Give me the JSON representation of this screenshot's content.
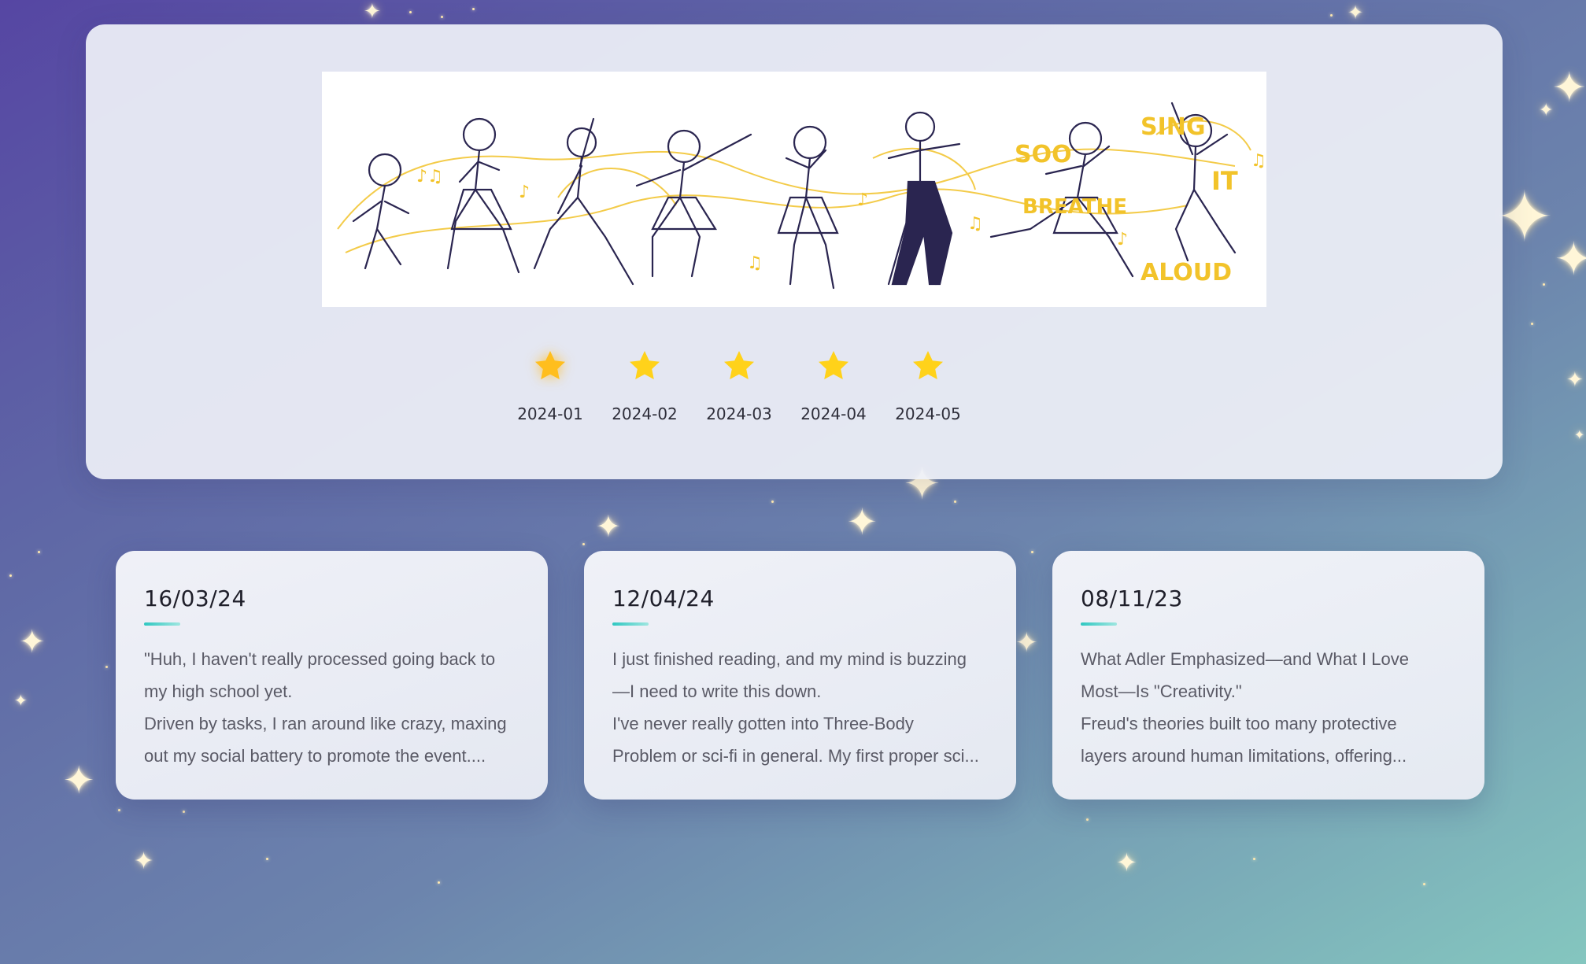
{
  "banner": {
    "image_name": "dancing-characters-illustration",
    "lettering": [
      "SOO",
      "BREATHE",
      "SING IT",
      "ALOUD"
    ]
  },
  "timeline": {
    "active_index": 0,
    "items": [
      {
        "label": "2024-01",
        "icon": "star-icon"
      },
      {
        "label": "2024-02",
        "icon": "star-icon"
      },
      {
        "label": "2024-03",
        "icon": "star-icon"
      },
      {
        "label": "2024-04",
        "icon": "star-icon"
      },
      {
        "label": "2024-05",
        "icon": "star-icon"
      }
    ]
  },
  "cards": [
    {
      "date": "16/03/24",
      "lines": [
        "\"Huh, I haven't really processed going back to",
        "my high school yet.",
        "Driven by tasks, I ran around like crazy, maxing",
        "out my social battery to promote the event...."
      ]
    },
    {
      "date": "12/04/24",
      "lines": [
        "I just finished reading, and my mind is buzzing",
        "—I need to write this down.",
        "I've never really gotten into Three-Body",
        "Problem or sci-fi in general. My first proper sci..."
      ]
    },
    {
      "date": "08/11/23",
      "lines": [
        "What Adler Emphasized—and What I Love",
        "Most—Is \"Creativity.\"",
        "Freud's theories built too many protective",
        "layers around human limitations, offering..."
      ]
    }
  ],
  "colors": {
    "star": "#ffd21a",
    "star_active": "#ffbe1e",
    "accent_rule": "#2ec7c1",
    "sketch_line": "#2a2550",
    "sketch_gold": "#f2c32a"
  }
}
